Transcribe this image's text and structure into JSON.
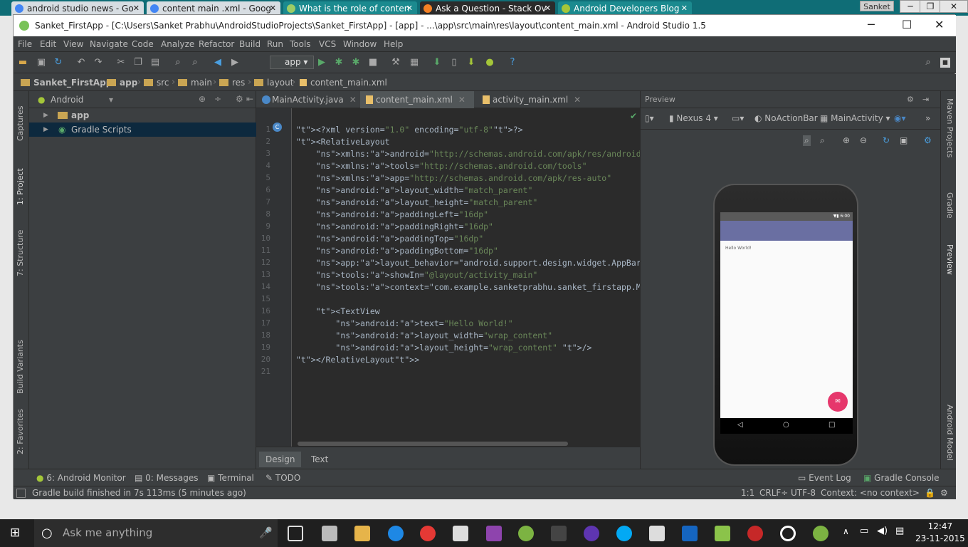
{
  "browser": {
    "tabs": [
      {
        "label": "android studio news - Go"
      },
      {
        "label": "content main .xml - Goog"
      },
      {
        "label": "What is the role of conten"
      },
      {
        "label": "Ask a Question - Stack Ov"
      },
      {
        "label": "Android Developers Blog"
      }
    ],
    "user": "Sanket"
  },
  "window": {
    "title": "Sanket_FirstApp - [C:\\Users\\Sanket Prabhu\\AndroidStudioProjects\\Sanket_FirstApp] - [app] - ...\\app\\src\\main\\res\\layout\\content_main.xml - Android Studio 1.5"
  },
  "menu": [
    "File",
    "Edit",
    "View",
    "Navigate",
    "Code",
    "Analyze",
    "Refactor",
    "Build",
    "Run",
    "Tools",
    "VCS",
    "Window",
    "Help"
  ],
  "toolbar": {
    "run_config": "app"
  },
  "breadcrumbs": [
    "Sanket_FirstApp",
    "app",
    "src",
    "main",
    "res",
    "layout",
    "content_main.xml"
  ],
  "left_strip": {
    "captures": "Captures",
    "project": "1: Project",
    "structure": "7: Structure",
    "build_variants": "Build Variants",
    "favorites": "2: Favorites"
  },
  "right_strip": {
    "maven": "Maven Projects",
    "gradle": "Gradle",
    "preview": "Preview",
    "android_model": "Android Model"
  },
  "project": {
    "view": "Android",
    "items": [
      {
        "label": "app"
      },
      {
        "label": "Gradle Scripts"
      }
    ]
  },
  "editor": {
    "tabs": [
      {
        "label": "MainActivity.java"
      },
      {
        "label": "content_main.xml"
      },
      {
        "label": "activity_main.xml"
      }
    ],
    "lines": [
      "<?xml version=\"1.0\" encoding=\"utf-8\"?>",
      "<RelativeLayout",
      "    xmlns:android=\"http://schemas.android.com/apk/res/android\"",
      "    xmlns:tools=\"http://schemas.android.com/tools\"",
      "    xmlns:app=\"http://schemas.android.com/apk/res-auto\"",
      "    android:layout_width=\"match_parent\"",
      "    android:layout_height=\"match_parent\"",
      "    android:paddingLeft=\"16dp\"",
      "    android:paddingRight=\"16dp\"",
      "    android:paddingTop=\"16dp\"",
      "    android:paddingBottom=\"16dp\"",
      "    app:layout_behavior=\"android.support.design.widget.AppBarLayout$S",
      "    tools:showIn=\"@layout/activity_main\"",
      "    tools:context=\"com.example.sanketprabhu.sanket_firstapp.MainActiv",
      "",
      "    <TextView",
      "        android:text=\"Hello World!\"",
      "        android:layout_width=\"wrap_content\"",
      "        android:layout_height=\"wrap_content\" />",
      "</RelativeLayout>",
      ""
    ],
    "line_numbers": [
      "1",
      "2",
      "3",
      "4",
      "5",
      "6",
      "7",
      "8",
      "9",
      "10",
      "11",
      "12",
      "13",
      "14",
      "15",
      "16",
      "17",
      "18",
      "19",
      "20",
      "21"
    ],
    "bottom_tabs": [
      "Design",
      "Text"
    ]
  },
  "preview": {
    "title": "Preview",
    "device": "Nexus 4",
    "theme": "NoActionBar",
    "activity": "MainActivity",
    "phone_time": "6:00",
    "hello_text": "Hello World!"
  },
  "bottom_tools": [
    "6: Android Monitor",
    "0: Messages",
    "Terminal",
    "TODO",
    "Event Log",
    "Gradle Console"
  ],
  "status": {
    "message": "Gradle build finished in 7s 113ms (5 minutes ago)",
    "position": "1:1",
    "line_sep": "CRLF÷",
    "encoding": "UTF-8",
    "context": "Context: <no context>"
  },
  "taskbar": {
    "search_placeholder": "Ask me anything",
    "time": "12:47",
    "date": "23-11-2015"
  }
}
